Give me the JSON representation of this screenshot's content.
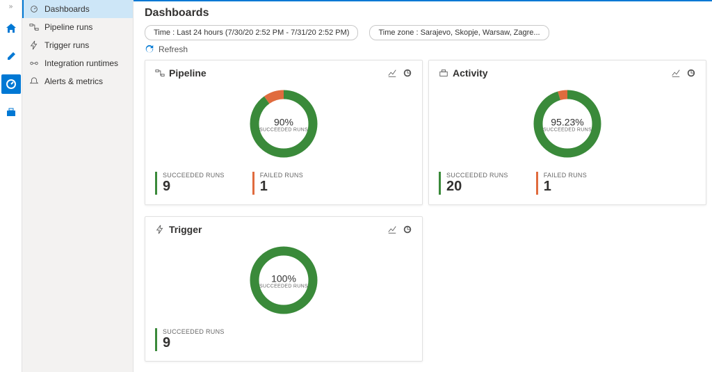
{
  "rail": {
    "items": [
      "collapse",
      "home",
      "edit",
      "monitor",
      "manage"
    ]
  },
  "sidebar": {
    "items": [
      {
        "label": "Dashboards",
        "icon": "gauge",
        "selected": true
      },
      {
        "label": "Pipeline runs",
        "icon": "pipeline",
        "selected": false
      },
      {
        "label": "Trigger runs",
        "icon": "trigger",
        "selected": false
      },
      {
        "label": "Integration runtimes",
        "icon": "integration",
        "selected": false
      },
      {
        "label": "Alerts & metrics",
        "icon": "alert",
        "selected": false
      }
    ]
  },
  "header": {
    "title": "Dashboards",
    "time_filter": "Time : Last 24 hours (7/30/20 2:52 PM - 7/31/20 2:52 PM)",
    "tz_filter": "Time zone : Sarajevo, Skopje, Warsaw, Zagre...",
    "refresh": "Refresh"
  },
  "cards": [
    {
      "id": "pipeline",
      "title": "Pipeline",
      "icon": "pipeline",
      "percent_label": "90%",
      "percent_sub": "SUCCEEDED RUNS",
      "percent": 90,
      "stats": [
        {
          "label": "SUCCEEDED RUNS",
          "value": "9",
          "kind": "succ"
        },
        {
          "label": "FAILED RUNS",
          "value": "1",
          "kind": "fail"
        }
      ]
    },
    {
      "id": "activity",
      "title": "Activity",
      "icon": "briefcase",
      "percent_label": "95.23%",
      "percent_sub": "SUCCEEDED RUNS",
      "percent": 95.23,
      "stats": [
        {
          "label": "SUCCEEDED RUNS",
          "value": "20",
          "kind": "succ"
        },
        {
          "label": "FAILED RUNS",
          "value": "1",
          "kind": "fail"
        }
      ]
    },
    {
      "id": "trigger",
      "title": "Trigger",
      "icon": "bolt",
      "percent_label": "100%",
      "percent_sub": "SUCCEEDED RUNS",
      "percent": 100,
      "stats": [
        {
          "label": "SUCCEEDED RUNS",
          "value": "9",
          "kind": "succ"
        }
      ]
    }
  ],
  "colors": {
    "success": "#3a8a3a",
    "fail": "#e06b3e",
    "accent": "#0078d4"
  },
  "chart_data": [
    {
      "type": "pie",
      "title": "Pipeline",
      "series": [
        {
          "name": "Succeeded runs",
          "value": 9,
          "percent": 90
        },
        {
          "name": "Failed runs",
          "value": 1,
          "percent": 10
        }
      ]
    },
    {
      "type": "pie",
      "title": "Activity",
      "series": [
        {
          "name": "Succeeded runs",
          "value": 20,
          "percent": 95.23
        },
        {
          "name": "Failed runs",
          "value": 1,
          "percent": 4.77
        }
      ]
    },
    {
      "type": "pie",
      "title": "Trigger",
      "series": [
        {
          "name": "Succeeded runs",
          "value": 9,
          "percent": 100
        }
      ]
    }
  ]
}
